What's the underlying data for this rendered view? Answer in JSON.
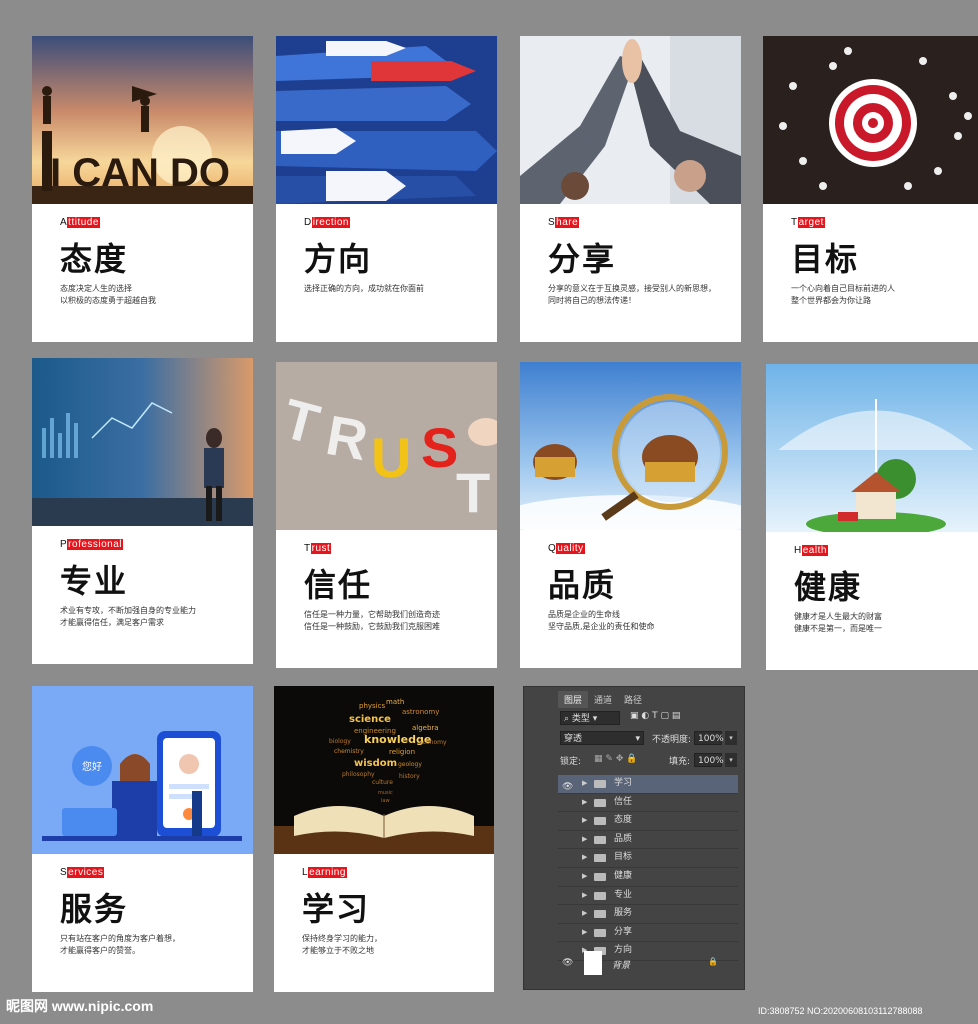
{
  "cards": [
    {
      "eng_first": "A",
      "eng_rest": "ttitude",
      "cn": "态度",
      "desc": [
        "态度决定人生的选择",
        "以积极的态度勇于超越自我"
      ],
      "image_text": "I CAN DO"
    },
    {
      "eng_first": "D",
      "eng_rest": "irection",
      "cn": "方向",
      "desc": [
        "选择正确的方向，成功就在你面前"
      ]
    },
    {
      "eng_first": "S",
      "eng_rest": "hare",
      "cn": "分享",
      "desc": [
        "分享的意义在于互换灵感，接受别人的新思想，",
        "同时将自己的想法传递！"
      ]
    },
    {
      "eng_first": "T",
      "eng_rest": "arget",
      "cn": "目标",
      "desc": [
        "一个心向着自己目标前进的人",
        "整个世界都会为你让路"
      ]
    },
    {
      "eng_first": "P",
      "eng_rest": "rofessional",
      "cn": "专业",
      "desc": [
        "术业有专攻，不断加强自身的专业能力",
        "才能赢得信任，满足客户需求"
      ]
    },
    {
      "eng_first": "T",
      "eng_rest": "rust",
      "cn": "信任",
      "desc": [
        "信任是一种力量，它帮助我们创造奇迹",
        "信任是一种鼓励，它鼓励我们克服困难"
      ],
      "image_text": "TRUST"
    },
    {
      "eng_first": "Q",
      "eng_rest": "uality",
      "cn": "品质",
      "desc": [
        "品质是企业的生命线",
        "坚守品质,是企业的责任和使命"
      ]
    },
    {
      "eng_first": "H",
      "eng_rest": "ealth",
      "cn": "健康",
      "desc": [
        "健康才是人生最大的财富",
        "健康不是第一，而是唯一"
      ]
    },
    {
      "eng_first": "S",
      "eng_rest": "ervices",
      "cn": "服务",
      "desc": [
        "只有站在客户的角度为客户着想，",
        "才能赢得客户的赞誉。"
      ],
      "image_text": "您好"
    },
    {
      "eng_first": "L",
      "eng_rest": "earning",
      "cn": "学习",
      "desc": [
        "保持终身学习的能力，",
        "才能够立于不败之地"
      ],
      "image_words": [
        "science",
        "knowledge",
        "wisdom",
        "physics",
        "math",
        "astronomy",
        "engineering",
        "algebra",
        "religion",
        "chemistry",
        "biology",
        "geology",
        "philosophy",
        "history",
        "economy",
        "culture",
        "music",
        "law"
      ]
    }
  ],
  "panel": {
    "tabs": [
      "图层",
      "通道",
      "路径"
    ],
    "filter_label": "类型",
    "blend_mode": "穿透",
    "opacity_label": "不透明度:",
    "opacity_value": "100%",
    "lock_label": "锁定:",
    "fill_label": "填充:",
    "fill_value": "100%",
    "layers": [
      "学习",
      "信任",
      "态度",
      "品质",
      "目标",
      "健康",
      "专业",
      "服务",
      "分享",
      "方向"
    ],
    "background_layer": "背景"
  },
  "footer": {
    "logo": "昵图网 www.nipic.com",
    "id": "ID:3808752 NO:20200608103112788088"
  },
  "colors": {
    "accent": "#e8141c",
    "page_bg": "#8c8c8c",
    "panel_bg": "#444444",
    "selected_layer": "#5a6478"
  }
}
